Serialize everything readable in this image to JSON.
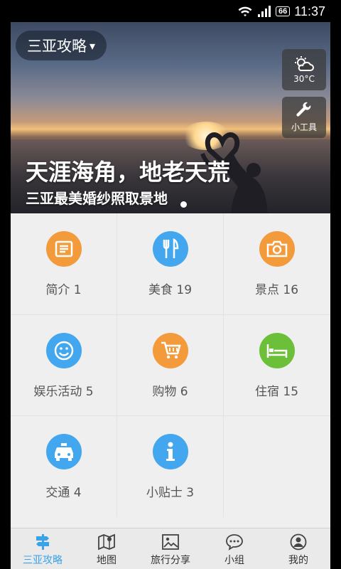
{
  "status_bar": {
    "battery": "66",
    "time": "11:37"
  },
  "hero": {
    "city": "三亚攻略",
    "city_caret": "▾",
    "weather_temp": "30°C",
    "tools_label": "小工具",
    "title": "天涯海角，地老天荒",
    "subtitle": "三亚最美婚纱照取景地"
  },
  "categories": [
    {
      "label": "简介 1",
      "color": "#f39a3b",
      "icon": "article-icon"
    },
    {
      "label": "美食 19",
      "color": "#42a7ee",
      "icon": "fork-knife-icon"
    },
    {
      "label": "景点 16",
      "color": "#f39a3b",
      "icon": "camera-icon"
    },
    {
      "label": "娱乐活动 5",
      "color": "#42a7ee",
      "icon": "smiley-icon"
    },
    {
      "label": "购物 6",
      "color": "#f39a3b",
      "icon": "cart-icon"
    },
    {
      "label": "住宿 15",
      "color": "#6cbf39",
      "icon": "bed-icon"
    },
    {
      "label": "交通 4",
      "color": "#42a7ee",
      "icon": "taxi-icon"
    },
    {
      "label": "小贴士 3",
      "color": "#42a7ee",
      "icon": "info-icon"
    }
  ],
  "tabs": [
    {
      "label": "三亚攻略",
      "icon": "signpost-icon",
      "active": true
    },
    {
      "label": "地图",
      "icon": "map-icon",
      "active": false
    },
    {
      "label": "旅行分享",
      "icon": "picture-icon",
      "active": false
    },
    {
      "label": "小组",
      "icon": "chat-icon",
      "active": false
    },
    {
      "label": "我的",
      "icon": "user-icon",
      "active": false
    }
  ],
  "accent_color": "#3aa3e8"
}
